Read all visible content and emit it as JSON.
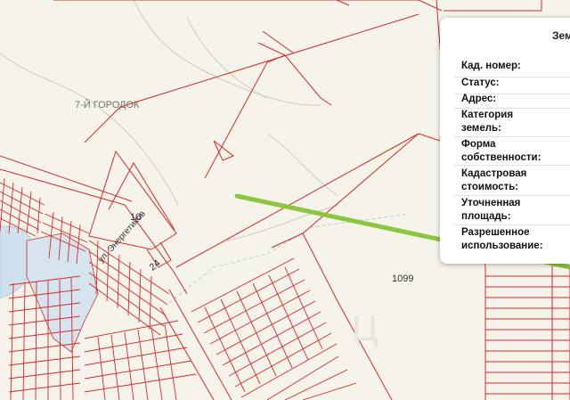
{
  "map": {
    "place_label": "7-Й ГОРОДОК",
    "street_label": "ул. Энергетиков",
    "parcels": {
      "p10": "10",
      "p24": "24",
      "p1099": "1099"
    },
    "colors": {
      "background": "#f6f4ea",
      "parcel_line": "#d42a2a",
      "water": "#cfe0ee",
      "arrow": "#8cc63f"
    }
  },
  "info_panel": {
    "title": "Зем",
    "fields": [
      {
        "label": "Кад. номер:",
        "value": ""
      },
      {
        "label": "Статус:",
        "value": ""
      },
      {
        "label": "Адрес:",
        "value": ""
      },
      {
        "label": "Категория земель:",
        "value": ""
      },
      {
        "label": "Форма собственности:",
        "value": ""
      },
      {
        "label": "Кадастровая стоимость:",
        "value": ""
      },
      {
        "label": "Уточненная площадь:",
        "value": ""
      },
      {
        "label": "Разрешенное использование:",
        "value": ""
      }
    ]
  }
}
